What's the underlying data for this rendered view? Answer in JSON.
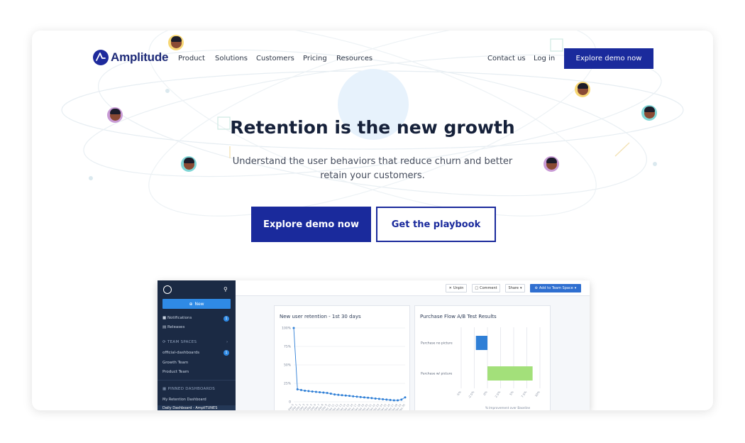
{
  "nav": {
    "brand": "Amplitude",
    "items": [
      "Product",
      "Solutions",
      "Customers",
      "Pricing",
      "Resources"
    ],
    "contact": "Contact us",
    "login": "Log in",
    "cta": "Explore demo now"
  },
  "hero": {
    "title": "Retention is the new growth",
    "subtitle": "Understand the user behaviors that reduce churn and better retain your customers.",
    "primary_button": "Explore demo now",
    "secondary_button": "Get the playbook"
  },
  "app": {
    "sidebar": {
      "new_button": "New",
      "notifications": "Notifications",
      "notifications_count": "1",
      "releases": "Releases",
      "team_spaces_heading": "TEAM SPACES",
      "team_spaces": [
        "official-dashboards",
        "Growth Team",
        "Product Team"
      ],
      "official_count": "1",
      "pinned_heading": "PINNED DASHBOARDS",
      "pinned": [
        "My Retention Dashboard",
        "Daily Dashboard - AmpliTUNES"
      ]
    },
    "toolbar": {
      "unpin": "Unpin",
      "comment": "Comment",
      "share": "Share",
      "add_to_team_space": "Add to Team Space"
    }
  },
  "chart_data": [
    {
      "type": "line",
      "title": "New user retention - 1st 30 days",
      "ylim": [
        0,
        100
      ],
      "y_ticks": [
        "100%",
        "75%",
        "50%",
        "25%",
        "0"
      ],
      "x": [
        "Day 0",
        "Day 1",
        "Day 2",
        "Day 3",
        "Day 4",
        "Day 5",
        "Day 6",
        "Day 7",
        "Day 8",
        "Day 9",
        "Day 10",
        "Day 11",
        "Day 12",
        "Day 13",
        "Day 14",
        "Day 15",
        "Day 16",
        "Day 17",
        "Day 18",
        "Day 19",
        "Day 20",
        "Day 21",
        "Day 22",
        "Day 23",
        "Day 24",
        "Day 25",
        "Day 26",
        "Day 27",
        "Day 28",
        "Day 29",
        "Day 30"
      ],
      "values": [
        100,
        17,
        16,
        15,
        14.5,
        14,
        13.5,
        13,
        12.5,
        12,
        11,
        10,
        9.5,
        9,
        8.5,
        8,
        7.5,
        7,
        6.5,
        6,
        5.5,
        5,
        4.5,
        4,
        3.5,
        3,
        2.5,
        2,
        2,
        3,
        6
      ],
      "color": "#2f7fd6"
    },
    {
      "type": "bar",
      "title": "Purchase Flow A/B Test Results",
      "categories": [
        "Purchase no picture",
        "Purchase w/ picture"
      ],
      "values": [
        -2.2,
        8.6
      ],
      "colors": [
        "#2f7fd6",
        "#a3e07a"
      ],
      "x_ticks": [
        "-5%",
        "-2.5%",
        "0%",
        "2.5%",
        "5%",
        "7.5%",
        "10%"
      ],
      "xlim": [
        -5,
        10
      ],
      "xlabel": "% Improvement over Baseline"
    }
  ],
  "colors": {
    "brand": "#1a2a9c",
    "heading": "#16213a",
    "sidebar": "#1b2a44",
    "accent_blue": "#2f8ae5"
  }
}
